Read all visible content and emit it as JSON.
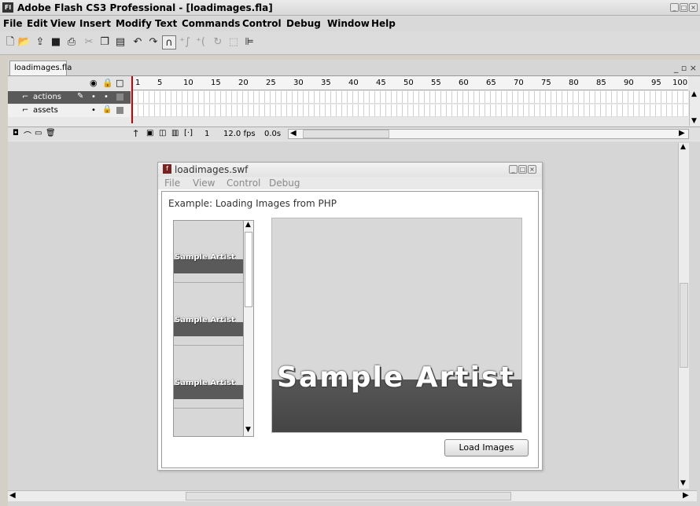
{
  "window": {
    "title": "Adobe Flash CS3 Professional - [loadimages.fla]",
    "app_icon": "Fl"
  },
  "menu": [
    "File",
    "Edit",
    "View",
    "Insert",
    "Modify",
    "Text",
    "Commands",
    "Control",
    "Debug",
    "Window",
    "Help"
  ],
  "toolbar": {
    "icons": [
      "new-icon",
      "open-icon",
      "import-icon",
      "save-icon",
      "print-icon",
      "cut-icon",
      "copy-icon",
      "paste-icon",
      "undo-icon",
      "redo-icon",
      "snap-magnet-icon",
      "smooth-icon",
      "straighten-icon",
      "rotate-icon",
      "scale-icon",
      "align-icon"
    ]
  },
  "document": {
    "tab": "loadimages.fla"
  },
  "timeline": {
    "frame_numbers": [
      "1",
      "5",
      "10",
      "15",
      "20",
      "25",
      "30",
      "35",
      "40",
      "45",
      "50",
      "55",
      "60",
      "65",
      "70",
      "75",
      "80",
      "85",
      "90",
      "95",
      "100"
    ],
    "layers": [
      {
        "name": "actions",
        "selected": true
      },
      {
        "name": "assets",
        "selected": false
      }
    ],
    "status": {
      "current_frame": "1",
      "fps": "12.0 fps",
      "time": "0.0s"
    }
  },
  "swf": {
    "title": "loadimages.swf",
    "menu": [
      "File",
      "View",
      "Control",
      "Debug"
    ],
    "heading": "Example: Loading Images from PHP",
    "thumbnails": [
      "Sample Artist",
      "Sample Artist",
      "Sample Artist"
    ],
    "preview_label": "Sample Artist",
    "button": "Load Images"
  },
  "colors": {
    "selected_layer": "#5a5a5a",
    "band": "#4d4d4d",
    "background": "#d6d6d6"
  }
}
